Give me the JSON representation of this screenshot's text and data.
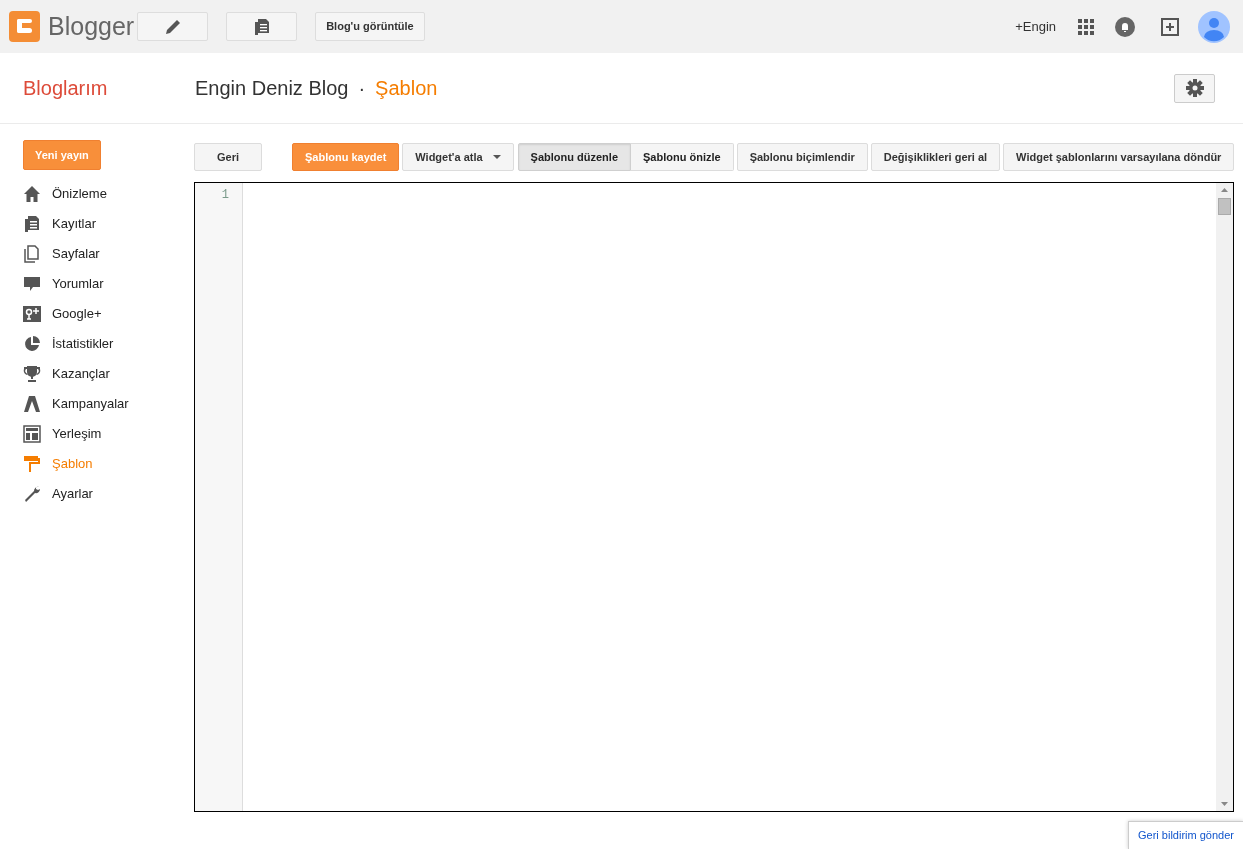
{
  "topbar": {
    "brand": "Blogger",
    "view_button": "Blog'u görüntüle",
    "account": "+Engin"
  },
  "header": {
    "section": "Bloglarım",
    "blog_title": "Engin Deniz Blog",
    "separator": "·",
    "page": "Şablon"
  },
  "sidebar": {
    "new_post": "Yeni yayın",
    "items": [
      {
        "label": "Önizleme",
        "selected": false
      },
      {
        "label": "Kayıtlar",
        "selected": false
      },
      {
        "label": "Sayfalar",
        "selected": false
      },
      {
        "label": "Yorumlar",
        "selected": false
      },
      {
        "label": "Google+",
        "selected": false
      },
      {
        "label": "İstatistikler",
        "selected": false
      },
      {
        "label": "Kazançlar",
        "selected": false
      },
      {
        "label": "Kampanyalar",
        "selected": false
      },
      {
        "label": "Yerleşim",
        "selected": false
      },
      {
        "label": "Şablon",
        "selected": true
      },
      {
        "label": "Ayarlar",
        "selected": false
      }
    ]
  },
  "toolbar": [
    {
      "kind": "button",
      "label": "Geri"
    },
    {
      "kind": "primary",
      "label": "Şablonu kaydet"
    },
    {
      "kind": "dropdown",
      "label": "Widget'a atla"
    },
    {
      "kind": "segmented",
      "items": [
        {
          "label": "Şablonu düzenle",
          "selected": true
        },
        {
          "label": "Şablonu önizle",
          "selected": false
        }
      ]
    },
    {
      "kind": "button",
      "label": "Şablonu biçimlendir"
    },
    {
      "kind": "button",
      "label": "Değişiklikleri geri al"
    },
    {
      "kind": "button",
      "label": "Widget şablonlarını varsayılana döndür"
    }
  ],
  "editor": {
    "line_numbers": [
      "1"
    ]
  },
  "feedback": "Geri bildirim gönder"
}
